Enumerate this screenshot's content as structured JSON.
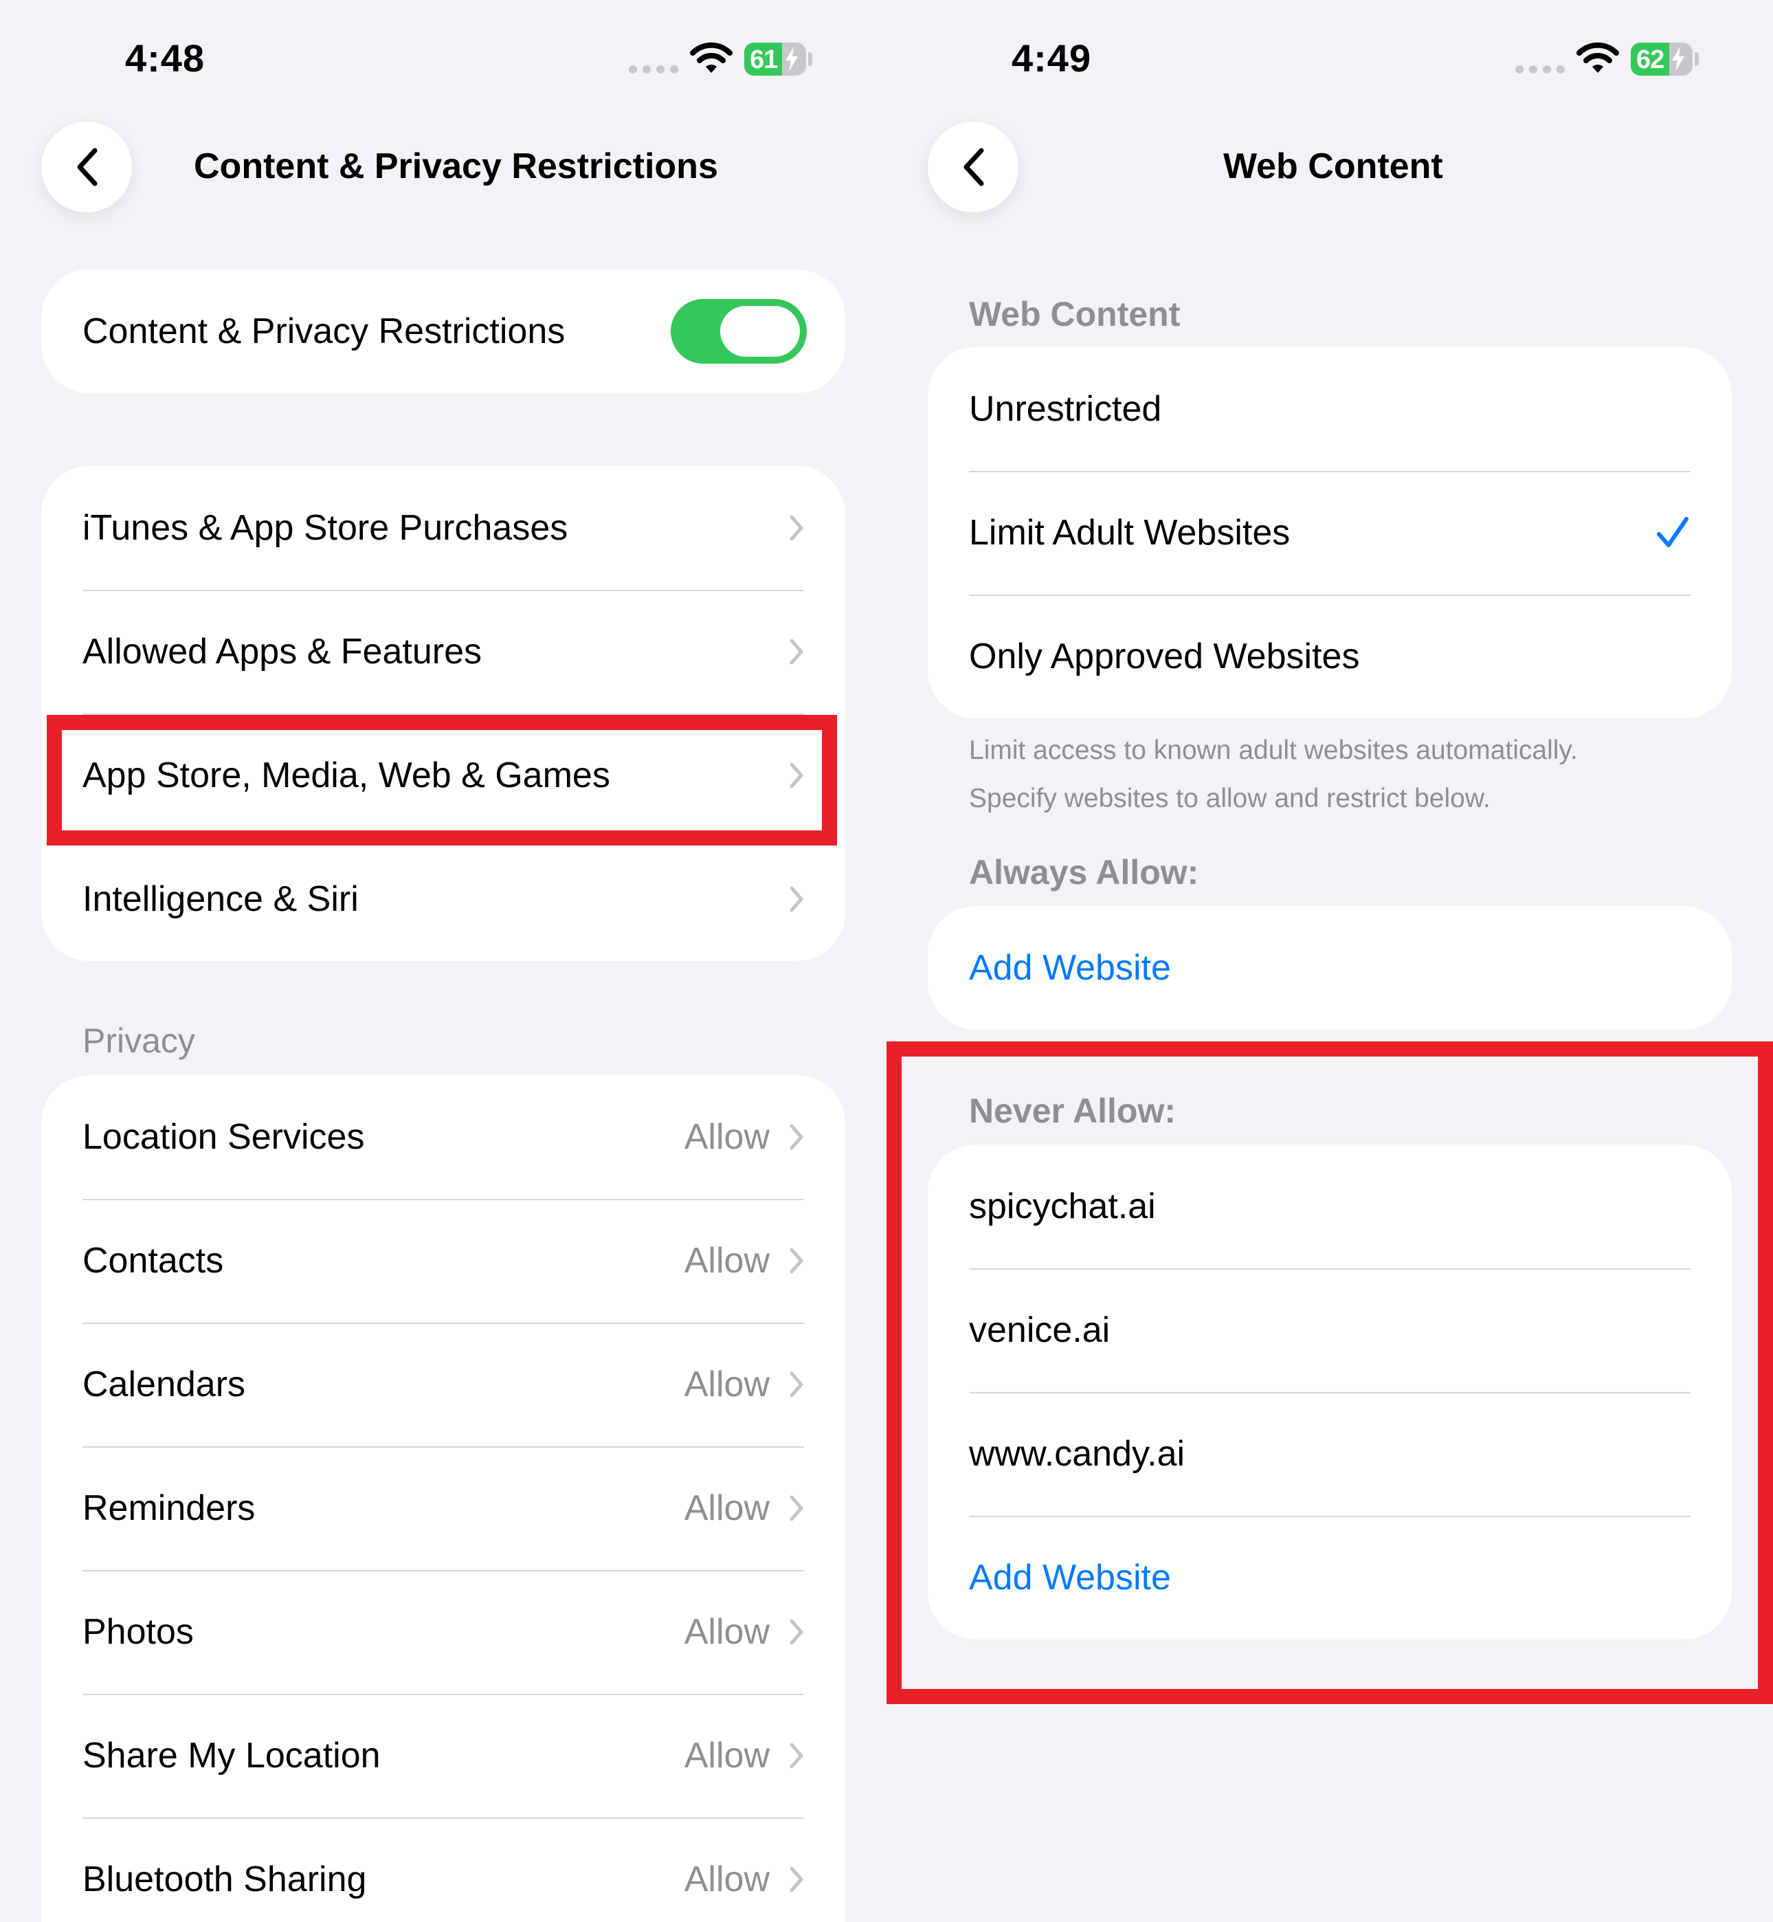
{
  "left": {
    "status": {
      "time": "4:48",
      "battery": "61",
      "battery_level": 0.61
    },
    "nav": {
      "title": "Content & Privacy Restrictions"
    },
    "master_toggle": {
      "label": "Content & Privacy Restrictions",
      "on": true
    },
    "menu_items": [
      {
        "label": "iTunes & App Store Purchases"
      },
      {
        "label": "Allowed Apps & Features"
      },
      {
        "label": "App Store, Media, Web & Games",
        "highlighted": true
      },
      {
        "label": "Intelligence & Siri"
      }
    ],
    "privacy": {
      "header": "Privacy",
      "items": [
        {
          "label": "Location Services",
          "value": "Allow"
        },
        {
          "label": "Contacts",
          "value": "Allow"
        },
        {
          "label": "Calendars",
          "value": "Allow"
        },
        {
          "label": "Reminders",
          "value": "Allow"
        },
        {
          "label": "Photos",
          "value": "Allow"
        },
        {
          "label": "Share My Location",
          "value": "Allow"
        },
        {
          "label": "Bluetooth Sharing",
          "value": "Allow"
        }
      ]
    }
  },
  "right": {
    "status": {
      "time": "4:49",
      "battery": "62",
      "battery_level": 0.62
    },
    "nav": {
      "title": "Web Content"
    },
    "web_content": {
      "header": "Web Content",
      "options": [
        {
          "label": "Unrestricted",
          "selected": false
        },
        {
          "label": "Limit Adult Websites",
          "selected": true
        },
        {
          "label": "Only Approved Websites",
          "selected": false
        }
      ],
      "footer_line1": "Limit access to known adult websites automatically.",
      "footer_line2": "Specify websites to allow and restrict below."
    },
    "always_allow": {
      "header": "Always Allow:",
      "add_label": "Add Website"
    },
    "never_allow": {
      "header": "Never Allow:",
      "sites": [
        "spicychat.ai",
        "venice.ai",
        "www.candy.ai"
      ],
      "add_label": "Add Website"
    }
  },
  "colors": {
    "accent": "#007aff",
    "toggle_on": "#34c759",
    "highlight": "#e8202a",
    "background": "#f2f2f7"
  }
}
